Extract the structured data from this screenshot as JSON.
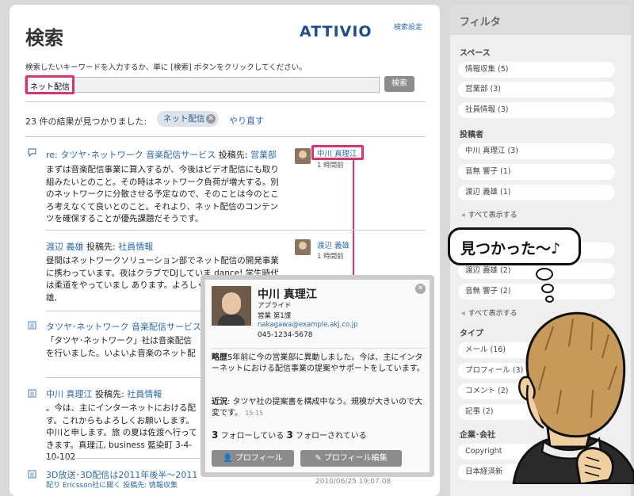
{
  "page": {
    "title": "検索",
    "logo": "ATTIVIO",
    "search_settings_link": "検索設定",
    "instructions": "検索したいキーワードを入力するか、単に [検索] ボタンをクリックしてください。",
    "search_value": "ネット配信",
    "search_button": "検索",
    "result_count": "23 件の結果が見つかりました:",
    "chip_label": "ネット配信",
    "redo_link": "やり直す"
  },
  "results": [
    {
      "head_link": "re: タツヤ･ネットワーク 音楽配信サービス",
      "posted_to": "投稿先:",
      "space": "営業部",
      "body": "まずは音楽配信事業に算入するが、今後はビデオ配信にも取り組みたいとのこと。その時はネットワーク負荷が増大する。別のネットワークに分散させる予定なので、そのことは今のところ考えなくて良いとのこと。それより、ネット配信のコンテンツを確保することが優先課題だそうです。",
      "author": "中川 真理江",
      "time": "1 時間前"
    },
    {
      "head_link": "渡辺 義雄",
      "posted_to": "投稿先:",
      "space": "社員情報",
      "body": "昼間はネットワークソリューション部でネット配信の開発事業に携わっています。夜はクラブでDJしていま dance! 学生時代は柔道をやっていまし あります。よろしくお願いします。義雄,",
      "author": "渡辺 義雄",
      "time": "1 時間前"
    },
    {
      "head_link": "タツヤ･ネットワーク 音楽配信サービス",
      "body": "「タツヤ･ネットワーク」社は音楽配信 を行いました。いよいよ音楽のネット配"
    },
    {
      "head_link": "中川 真理江",
      "posted_to": "投稿先:",
      "space": "社員情報",
      "body": "。今は、主にインターネットにおける配 す。これからもよろしくお願いします。中川と申します。旅 の夏は佐渡へ行ってきます。真理江, business 藍染町 3-4-10-102"
    },
    {
      "head_link": "3D放送･3D配信は2011年後半〜2011",
      "line2": "配り Ericsson社に聞く 投稿先: 情報収集",
      "timestamp": "2010/06/25 19:07:08"
    }
  ],
  "popup": {
    "name": "中川 真理江",
    "role": "アプライド",
    "dept": "営業 第1課",
    "email": "nakagawa@example.akj.co.jp",
    "phone": "045-1234-5678",
    "bio_label": "略歴",
    "bio": "5年前に今の営業部に異動しました。今は、主にインターネットにおける配信事業の提案やサポートをしています。",
    "status_label": "近況",
    "status": ": タツヤ社の提案書を構成中なう。規模が大きいので大変です。",
    "status_time": "15:15",
    "following_count": "3",
    "following_label": "フォローしている",
    "followers_count": "3",
    "followers_label": "フォローされている",
    "profile_button": "プロフィール",
    "edit_button": "プロフィール編集"
  },
  "sidebar": {
    "title": "フィルタ",
    "space_heading": "スペース",
    "spaces": [
      "情報収集 (5)",
      "営業部 (3)",
      "社員情報 (3)"
    ],
    "author_heading": "投稿者",
    "authors": [
      "中川 真理江 (3)",
      "音無 響子 (1)",
      "渡辺 義雄 (1)"
    ],
    "show_all": "すべて表示する",
    "authors2": [
      "渡辺 義雄 (2)",
      "音無 響子 (2)"
    ],
    "show_all2": "すべて表示する",
    "type_heading": "タイプ",
    "types": [
      "メール (16)",
      "プロフィール (3)",
      "コメント (2)",
      "記事 (2)"
    ],
    "company_heading": "企業･会社",
    "companies": [
      "Copyright",
      "日本経済新"
    ]
  },
  "bubble_text": "見つかった〜♪"
}
